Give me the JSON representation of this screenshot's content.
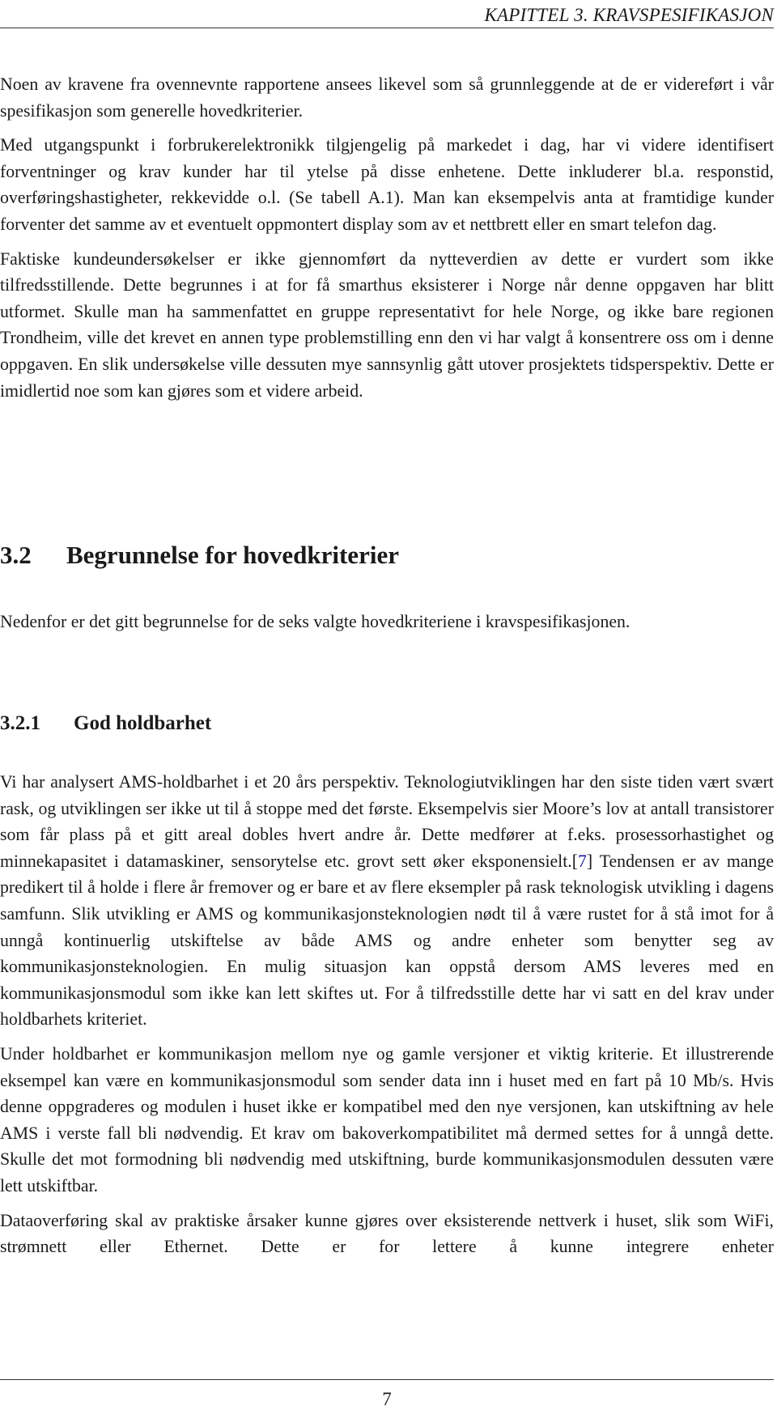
{
  "header": {
    "running_head": "KAPITTEL 3.  KRAVSPESIFIKASJON"
  },
  "intro": {
    "paragraphs": [
      "Noen av kravene fra ovennevnte rapportene ansees likevel som så grunnleggende at de er videreført i vår spesifikasjon som generelle hovedkriterier.",
      "Med utgangspunkt i forbrukerelektronikk tilgjengelig på markedet i dag, har vi videre identifisert forventninger og krav kunder har til ytelse på disse enhetene. Dette inkluderer bl.a. responstid, overføringshastigheter, rekkevidde o.l. (Se tabell A.1). Man kan eksempelvis anta at framtidige kunder forventer det samme av et eventuelt oppmontert display som av et nettbrett eller en smart telefon dag.",
      "Faktiske kundeundersøkelser er ikke gjennomført da nytteverdien av dette er vurdert som ikke tilfredsstillende. Dette begrunnes i at for få smarthus eksisterer i Norge når denne oppgaven har blitt utformet. Skulle man ha sammenfattet en gruppe representativt for hele Norge, og ikke bare regionen Trondheim, ville det krevet en annen type problemstilling enn den vi har valgt å konsentrere oss om i denne oppgaven. En slik undersøkelse ville dessuten mye sannsynlig gått utover prosjektets tidsperspektiv. Dette er imidlertid noe som kan gjøres som et videre arbeid."
    ]
  },
  "section": {
    "number": "3.2",
    "title": "Begrunnelse for hovedkriterier",
    "intro": "Nedenfor er det gitt begrunnelse for de seks valgte hovedkriteriene i kravspesifikasjonen."
  },
  "subsection": {
    "number": "3.2.1",
    "title": "God holdbarhet",
    "p1_before_cite": "Vi har analysert AMS-holdbarhet i et 20 års perspektiv. Teknologiutviklingen har den siste tiden vært svært rask, og utviklingen ser ikke ut til å stoppe med det første. Eksempelvis sier Moore’s lov at antall transistorer som får plass på et gitt areal dobles hvert andre år. Dette medfører at f.eks. prosessorhastighet og minnekapasitet i datamaskiner, sensorytelse etc. grovt sett øker eksponensielt.[",
    "citation": "7",
    "p1_after_cite": "] Tendensen er av mange predikert til å holde i flere år fremover og er bare et av flere eksempler på rask teknologisk utvikling i dagens samfunn. Slik utvikling er AMS og kommunikasjonsteknologien nødt til å være rustet for å stå imot for å unngå kontinuerlig utskiftelse av både AMS og andre enheter som benytter seg av kommunikasjonsteknologien. En mulig situasjon kan oppstå dersom AMS leveres med en kommunikasjonsmodul som ikke kan lett skiftes ut. For å tilfredsstille dette har vi satt en del krav under holdbarhets kriteriet.",
    "p2": "Under holdbarhet er kommunikasjon mellom nye og gamle versjoner et viktig kriterie. Et illustrerende eksempel kan være en kommunikasjonsmodul som sender data inn i huset med en fart på 10 Mb/s. Hvis denne oppgraderes og modulen i huset ikke er kompatibel med den nye versjonen, kan utskiftning av hele AMS i verste fall bli nødvendig. Et krav om bakoverkompatibilitet må dermed settes for å unngå dette. Skulle det mot formodning bli nødvendig med utskiftning, burde kommunikasjonsmodulen dessuten være lett utskiftbar.",
    "p3": "Dataoverføring skal av praktiske årsaker kunne gjøres over eksisterende nettverk i huset, slik som WiFi, strømnett eller Ethernet. Dette er for lettere å kunne integrere enheter"
  },
  "footer": {
    "page_number": "7"
  },
  "colors": {
    "citation_link": "#1a1a9a"
  }
}
